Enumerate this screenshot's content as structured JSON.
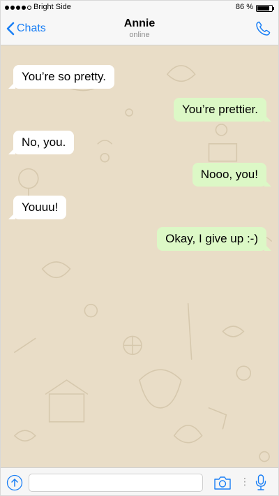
{
  "status_bar": {
    "carrier": "Bright Side",
    "battery": "86 %",
    "battery_level": 0.86
  },
  "nav": {
    "back_label": "Chats",
    "contact_name": "Annie",
    "contact_status": "online"
  },
  "messages": [
    {
      "direction": "in",
      "text": "You’re so pretty."
    },
    {
      "direction": "out",
      "text": "You’re prettier."
    },
    {
      "direction": "in",
      "text": "No, you."
    },
    {
      "direction": "out",
      "text": "Nooo, you!"
    },
    {
      "direction": "in",
      "text": "Youuu!"
    },
    {
      "direction": "out",
      "text": "Okay, I give up :-)"
    }
  ],
  "input": {
    "value": "",
    "placeholder": ""
  },
  "colors": {
    "accent": "#1a7ff5",
    "incoming_bubble": "#ffffff",
    "outgoing_bubble": "#dcf8c6",
    "wallpaper": "#e9ddc7"
  },
  "icons": [
    "signal-dots-icon",
    "battery-icon",
    "chevron-left-icon",
    "phone-call-icon",
    "upload-icon",
    "camera-icon",
    "microphone-icon"
  ]
}
